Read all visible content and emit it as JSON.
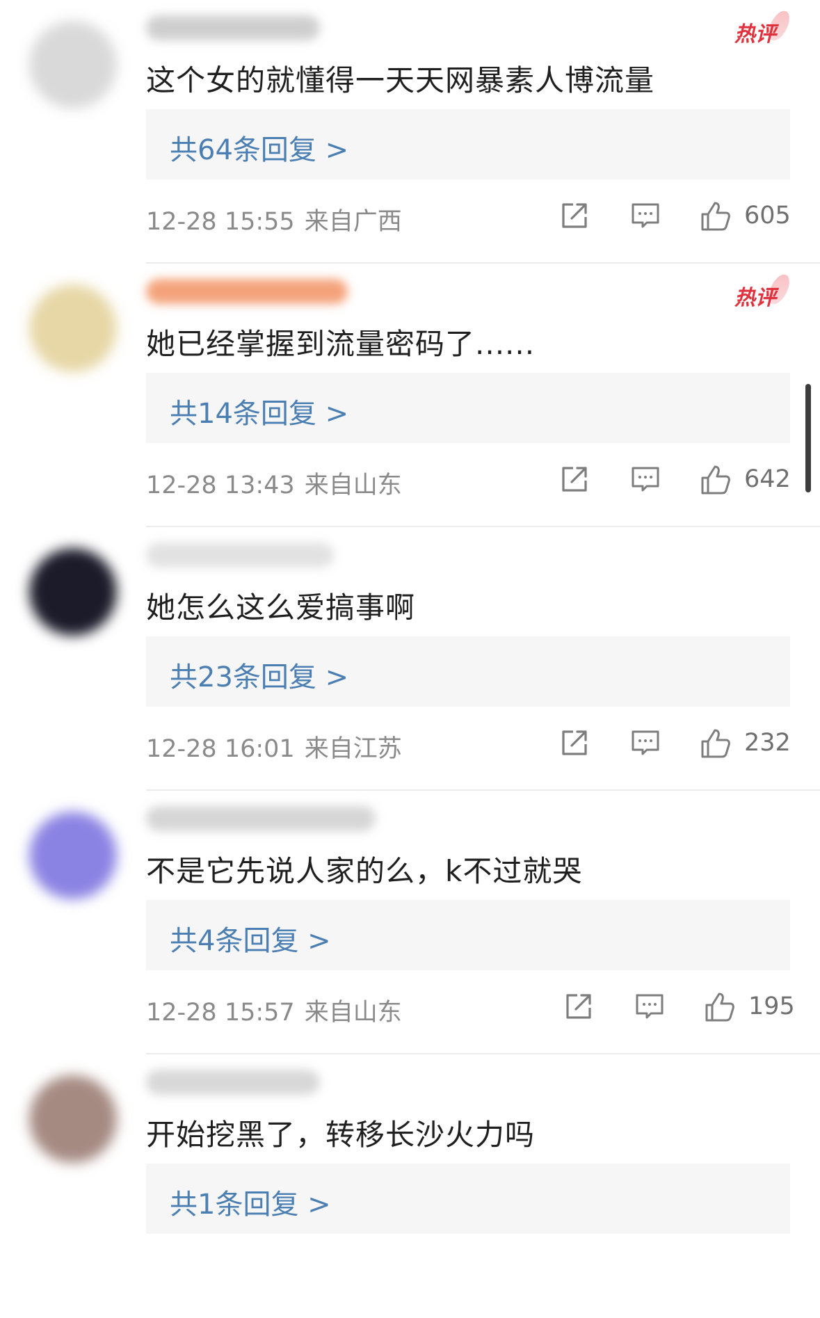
{
  "comments": [
    {
      "avatar_color": "#d9d9d9",
      "username_color": "#cfcfcf",
      "hot": true,
      "text": "这个女的就懂得一天天网暴素人博流量",
      "reply_label": "共64条回复 >",
      "time": "12-28 15:55",
      "location": "来自广西",
      "likes": "605"
    },
    {
      "avatar_color": "#e7d7a6",
      "username_color": "#f4a27a",
      "hot": true,
      "text": "她已经掌握到流量密码了......",
      "reply_label": "共14条回复 >",
      "time": "12-28 13:43",
      "location": "来自山东",
      "likes": "642"
    },
    {
      "avatar_color": "#1b1b2a",
      "username_color": "#e2e2e2",
      "hot": false,
      "text": "她怎么这么爱搞事啊",
      "reply_label": "共23条回复 >",
      "time": "12-28 16:01",
      "location": "来自江苏",
      "likes": "232"
    },
    {
      "avatar_color": "#8b83e3",
      "username_color": "#d6d6d6",
      "hot": false,
      "text": "不是它先说人家的么，k不过就哭",
      "reply_label": "共4条回复 >",
      "time": "12-28 15:57",
      "location": "来自山东",
      "likes": "195"
    },
    {
      "avatar_color": "#a58a82",
      "username_color": "#d8d8d8",
      "hot": false,
      "text": "开始挖黑了，转移长沙火力吗",
      "reply_label": "共1条回复 >",
      "time": "",
      "location": "",
      "likes": ""
    }
  ],
  "hot_badge_label": "热评",
  "icons": {
    "share": "share-icon",
    "comment": "comment-icon",
    "like": "thumbs-up-icon"
  },
  "colors": {
    "reply_link": "#4b7fb3",
    "hot_badge": "#e0323c",
    "meta_text": "#8a8a8a"
  }
}
